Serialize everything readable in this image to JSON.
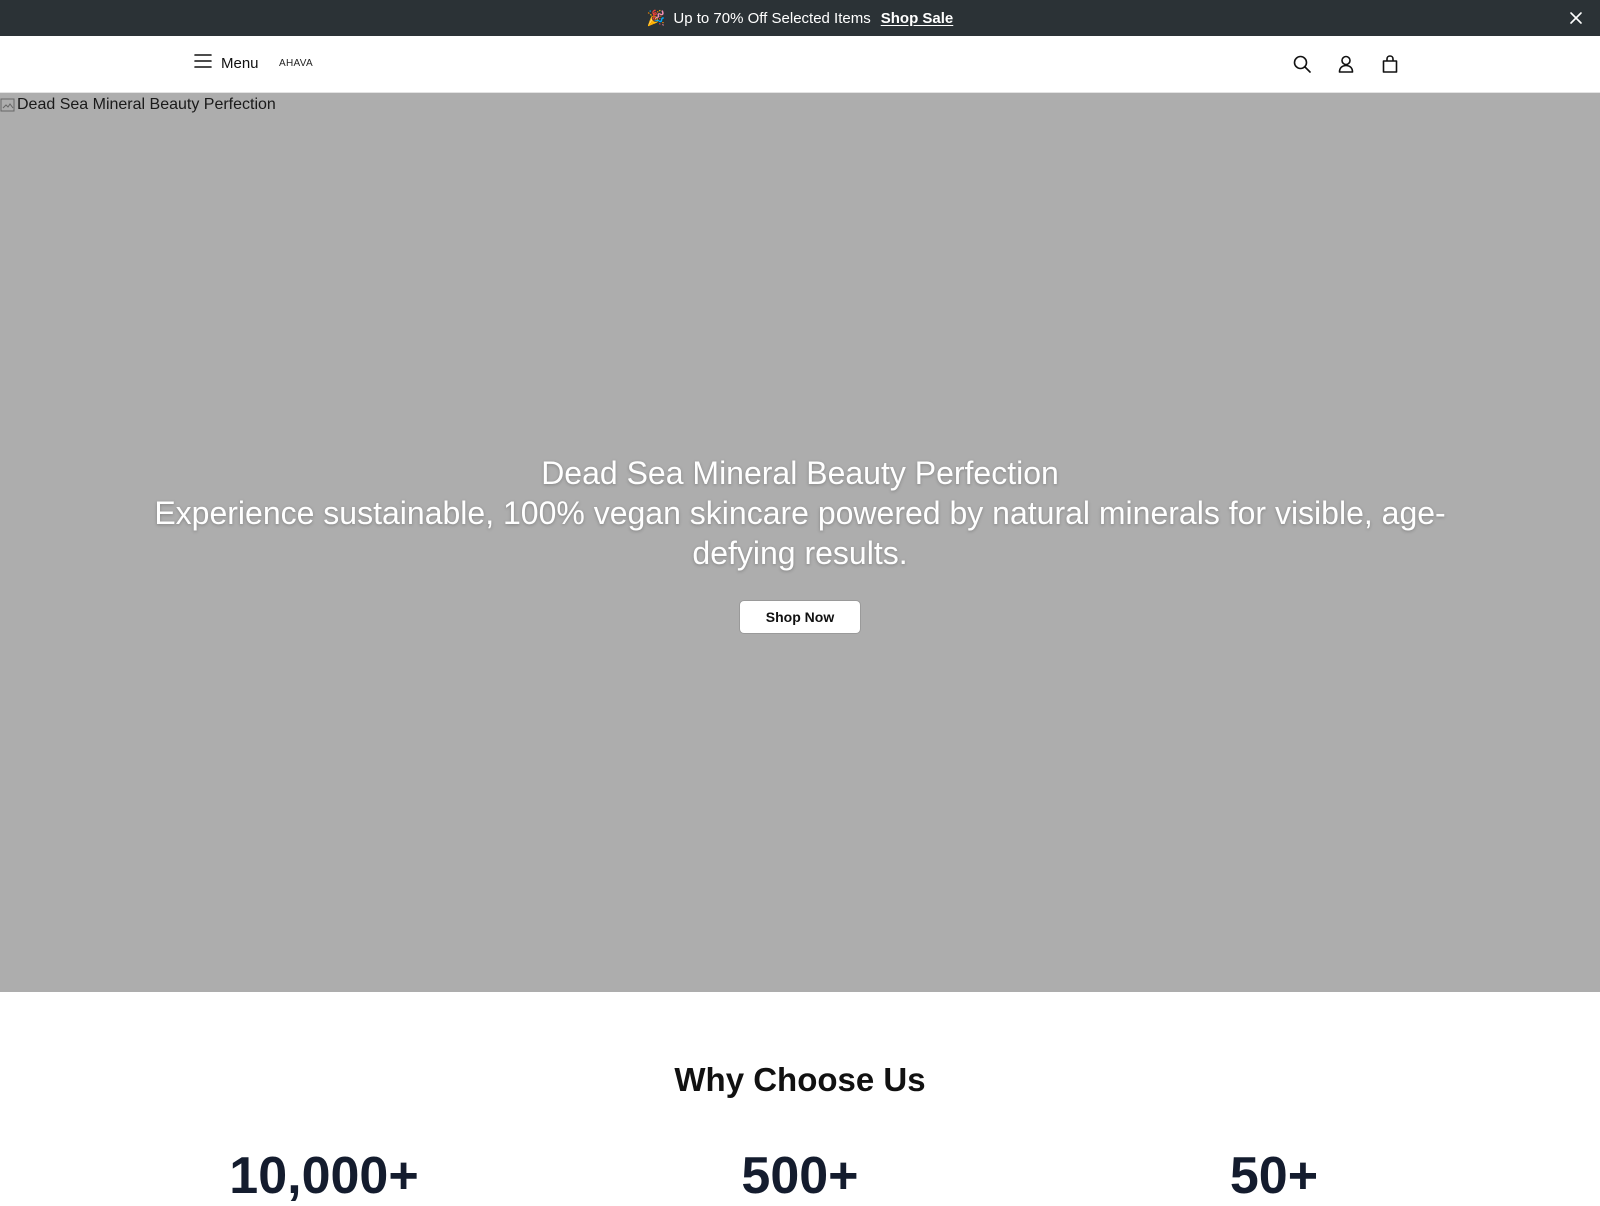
{
  "announcement": {
    "emoji": "🎉",
    "text": "Up to 70% Off Selected Items",
    "link_label": "Shop Sale",
    "close_icon": "close-icon"
  },
  "header": {
    "menu_label": "Menu",
    "logo_text": "AHAVA",
    "icons": [
      "search-icon",
      "account-icon",
      "bag-icon"
    ]
  },
  "hero": {
    "image_alt": "Dead Sea Mineral Beauty Perfection",
    "title": "Dead Sea Mineral Beauty Perfection",
    "subtitle": "Experience sustainable, 100% vegan skincare powered by natural minerals for visible, age-defying results.",
    "cta_label": "Shop Now",
    "background_color": "#adadad"
  },
  "why": {
    "title": "Why Choose Us",
    "stats": [
      "10,000+",
      "500+",
      "50+"
    ]
  },
  "colors": {
    "announcement_bg": "#2b3236",
    "stat_color": "#141c2e"
  }
}
